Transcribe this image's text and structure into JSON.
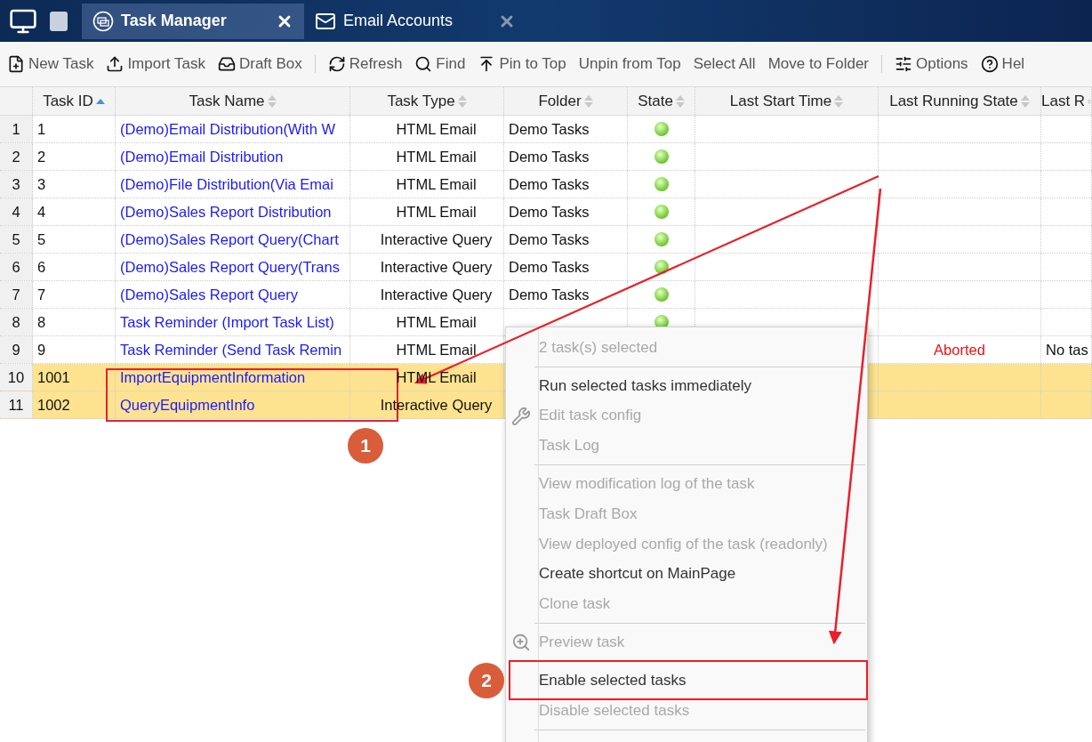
{
  "title_bar": {
    "tabs": [
      {
        "label": "Task Manager",
        "selected": true
      },
      {
        "label": "Email Accounts",
        "selected": false
      }
    ]
  },
  "toolbar": [
    {
      "kind": "button",
      "label": "New Task"
    },
    {
      "kind": "button",
      "label": "Import Task"
    },
    {
      "kind": "button",
      "label": "Draft Box"
    },
    {
      "kind": "separator"
    },
    {
      "kind": "button",
      "label": "Refresh"
    },
    {
      "kind": "button",
      "label": "Find"
    },
    {
      "kind": "button",
      "label": "Pin to Top"
    },
    {
      "kind": "button",
      "label": "Unpin from Top"
    },
    {
      "kind": "button",
      "label": "Select All"
    },
    {
      "kind": "button",
      "label": "Move to Folder"
    },
    {
      "kind": "separator"
    },
    {
      "kind": "button",
      "label": "Options"
    },
    {
      "kind": "button",
      "label": "Hel"
    }
  ],
  "table": {
    "columns": [
      {
        "label": "Task ID",
        "sorted_ascending": true
      },
      {
        "label": "Task Name",
        "sorted_ascending": false
      },
      {
        "label": "Task Type",
        "sorted_ascending": false
      },
      {
        "label": "Folder",
        "sorted_ascending": false
      },
      {
        "label": "State",
        "sorted_ascending": false
      },
      {
        "label": "Last Start Time",
        "sorted_ascending": false
      },
      {
        "label": "Last Running State",
        "sorted_ascending": false
      },
      {
        "label": "Last R",
        "sorted_ascending": false
      }
    ],
    "rows": [
      {
        "num": "1",
        "id": "1",
        "name": "(Demo)Email Distribution(With W",
        "type": "HTML Email",
        "folder": "Demo Tasks",
        "enabled": true,
        "selected": false
      },
      {
        "num": "2",
        "id": "2",
        "name": "(Demo)Email Distribution",
        "type": "HTML Email",
        "folder": "Demo Tasks",
        "enabled": true,
        "selected": false
      },
      {
        "num": "3",
        "id": "3",
        "name": "(Demo)File Distribution(Via Emai",
        "type": "HTML Email",
        "folder": "Demo Tasks",
        "enabled": true,
        "selected": false
      },
      {
        "num": "4",
        "id": "4",
        "name": "(Demo)Sales Report Distribution",
        "type": "HTML Email",
        "folder": "Demo Tasks",
        "enabled": true,
        "selected": false
      },
      {
        "num": "5",
        "id": "5",
        "name": "(Demo)Sales Report Query(Chart",
        "type": "Interactive Query",
        "folder": "Demo Tasks",
        "enabled": true,
        "selected": false
      },
      {
        "num": "6",
        "id": "6",
        "name": "(Demo)Sales Report Query(Trans",
        "type": "Interactive Query",
        "folder": "Demo Tasks",
        "enabled": true,
        "selected": false
      },
      {
        "num": "7",
        "id": "7",
        "name": "(Demo)Sales Report Query",
        "type": "Interactive Query",
        "folder": "Demo Tasks",
        "enabled": true,
        "selected": false
      },
      {
        "num": "8",
        "id": "8",
        "name": "Task Reminder (Import Task List)",
        "type": "HTML Email",
        "enabled": true,
        "selected": false
      },
      {
        "num": "9",
        "id": "9",
        "name": "Task Reminder (Send Task Remin",
        "type": "HTML Email",
        "last_running_state": "Aborted",
        "last_r": "No tas",
        "selected": false
      },
      {
        "num": "10",
        "id": "1001",
        "name": "ImportEquipmentInformation",
        "type": "HTML Email",
        "selected": true
      },
      {
        "num": "11",
        "id": "1002",
        "name": "QueryEquipmentInfo",
        "type": "Interactive Query",
        "selected": true
      }
    ]
  },
  "context_menu": [
    {
      "kind": "header",
      "label": "2 task(s) selected",
      "disabled": true
    },
    {
      "kind": "separator"
    },
    {
      "kind": "item",
      "label": "Run selected tasks immediately",
      "disabled": false
    },
    {
      "kind": "item",
      "label": "Edit task config",
      "disabled": true
    },
    {
      "kind": "item",
      "label": "Task Log",
      "disabled": true
    },
    {
      "kind": "separator"
    },
    {
      "kind": "item",
      "label": "View modification log of the task",
      "disabled": true
    },
    {
      "kind": "item",
      "label": "Task Draft Box",
      "disabled": true
    },
    {
      "kind": "item",
      "label": "View deployed config of the task (readonly)",
      "disabled": true
    },
    {
      "kind": "item",
      "label": "Create shortcut on MainPage",
      "disabled": false
    },
    {
      "kind": "item",
      "label": "Clone task",
      "disabled": true
    },
    {
      "kind": "separator"
    },
    {
      "kind": "item",
      "label": "Preview task",
      "disabled": true
    },
    {
      "kind": "separator"
    },
    {
      "kind": "item",
      "label": "Enable selected tasks",
      "disabled": false
    },
    {
      "kind": "item",
      "label": "Disable selected tasks",
      "disabled": true
    },
    {
      "kind": "separator"
    }
  ],
  "annotations": [
    {
      "label": "1"
    },
    {
      "label": "2"
    }
  ]
}
